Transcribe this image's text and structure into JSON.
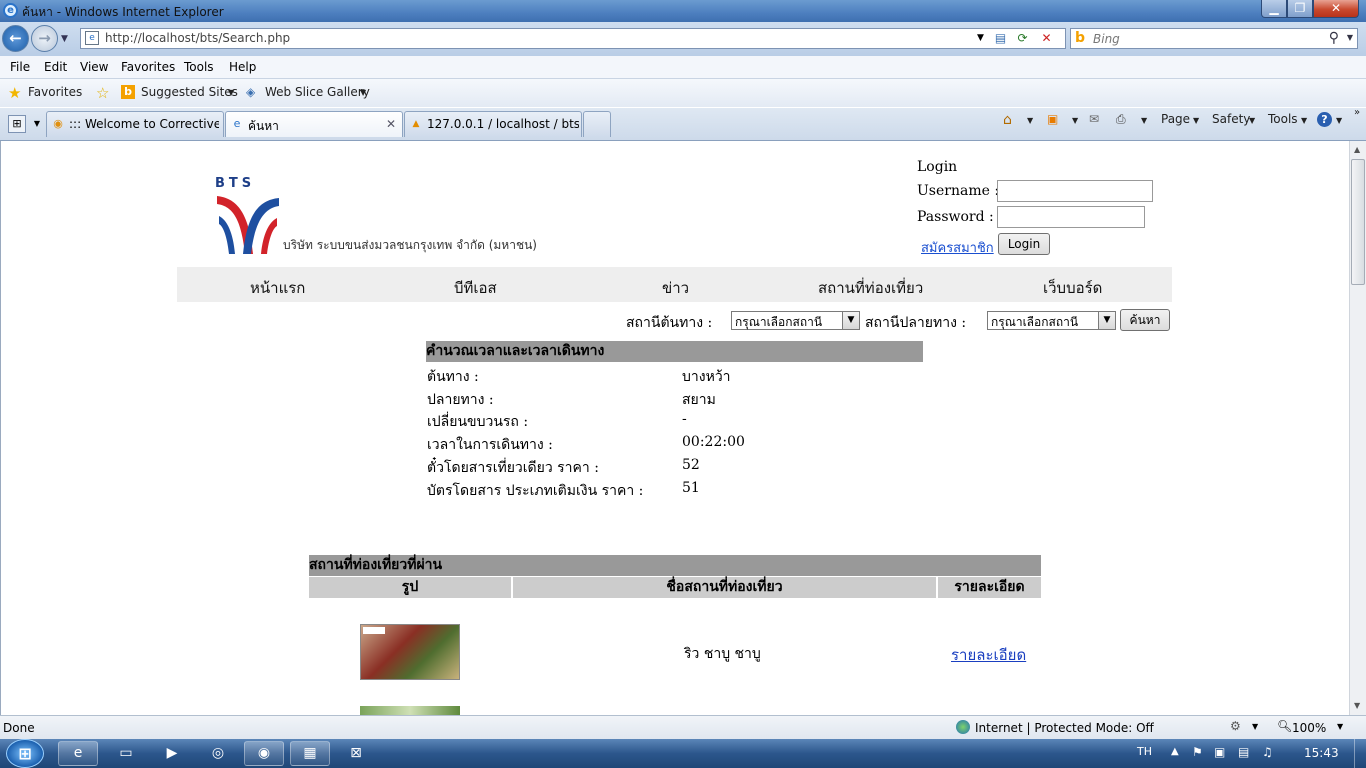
{
  "window": {
    "title": "ค้นหา - Windows Internet Explorer",
    "minimize": "▁",
    "maximize": "❐",
    "close": "✕"
  },
  "address": {
    "url": "http://localhost/bts/Search.php",
    "search_placeholder": "Bing"
  },
  "menu": [
    "File",
    "Edit",
    "View",
    "Favorites",
    "Tools",
    "Help"
  ],
  "favorites": {
    "label": "Favorites",
    "suggested": "Suggested Sites",
    "webslice": "Web Slice Gallery"
  },
  "tabs": [
    {
      "label": "::: Welcome to Corrective ..."
    },
    {
      "label": "ค้นหา"
    },
    {
      "label": "127.0.0.1 / localhost / bts /..."
    }
  ],
  "commandbar": [
    "Page",
    "Safety",
    "Tools"
  ],
  "page": {
    "company": "บริษัท ระบบขนส่งมวลชนกรุงเทพ จำกัด (มหาชน)",
    "logo_text": "BTS",
    "login": {
      "title": "Login",
      "username_label": "Username :",
      "password_label": "Password :",
      "register": "สมัครสมาชิก",
      "button": "Login"
    },
    "nav": [
      "หน้าแรก",
      "บีทีเอส",
      "ข่าว",
      "สถานที่ท่องเที่ยว",
      "เว็บบอร์ด"
    ],
    "search": {
      "origin_label": "สถานีต้นทาง :",
      "origin_value": "กรุณาเลือกสถานี",
      "dest_label": "สถานีปลายทาง :",
      "dest_value": "กรุณาเลือกสถานี",
      "button": "ค้นหา"
    },
    "calc": {
      "header": "คำนวณเวลาและเวลาเดินทาง",
      "rows": [
        {
          "label": "ต้นทาง :",
          "value": "บางหว้า"
        },
        {
          "label": "ปลายทาง :",
          "value": "สยาม"
        },
        {
          "label": "เปลี่ยนขบวนรถ :",
          "value": "-"
        },
        {
          "label": "เวลาในการเดินทาง :",
          "value": "00:22:00"
        },
        {
          "label": "ตั๋วโดยสารเที่ยวเดียว ราคา :",
          "value": "52"
        },
        {
          "label": "บัตรโดยสาร ประเภทเติมเงิน ราคา :",
          "value": "51"
        }
      ]
    },
    "attractions": {
      "header": "สถานที่ท่องเที่ยวที่ผ่าน",
      "columns": [
        "รูป",
        "ชื่อสถานที่ท่องเที่ยว",
        "รายละเอียด"
      ],
      "rows": [
        {
          "name": "ริว ชาบู ชาบู",
          "detail": "รายละเอียด"
        }
      ]
    }
  },
  "status": {
    "text": "Done",
    "zone": "Internet | Protected Mode: Off",
    "zoom": "100%"
  },
  "taskbar": {
    "lang": "TH",
    "clock": "15:43"
  }
}
